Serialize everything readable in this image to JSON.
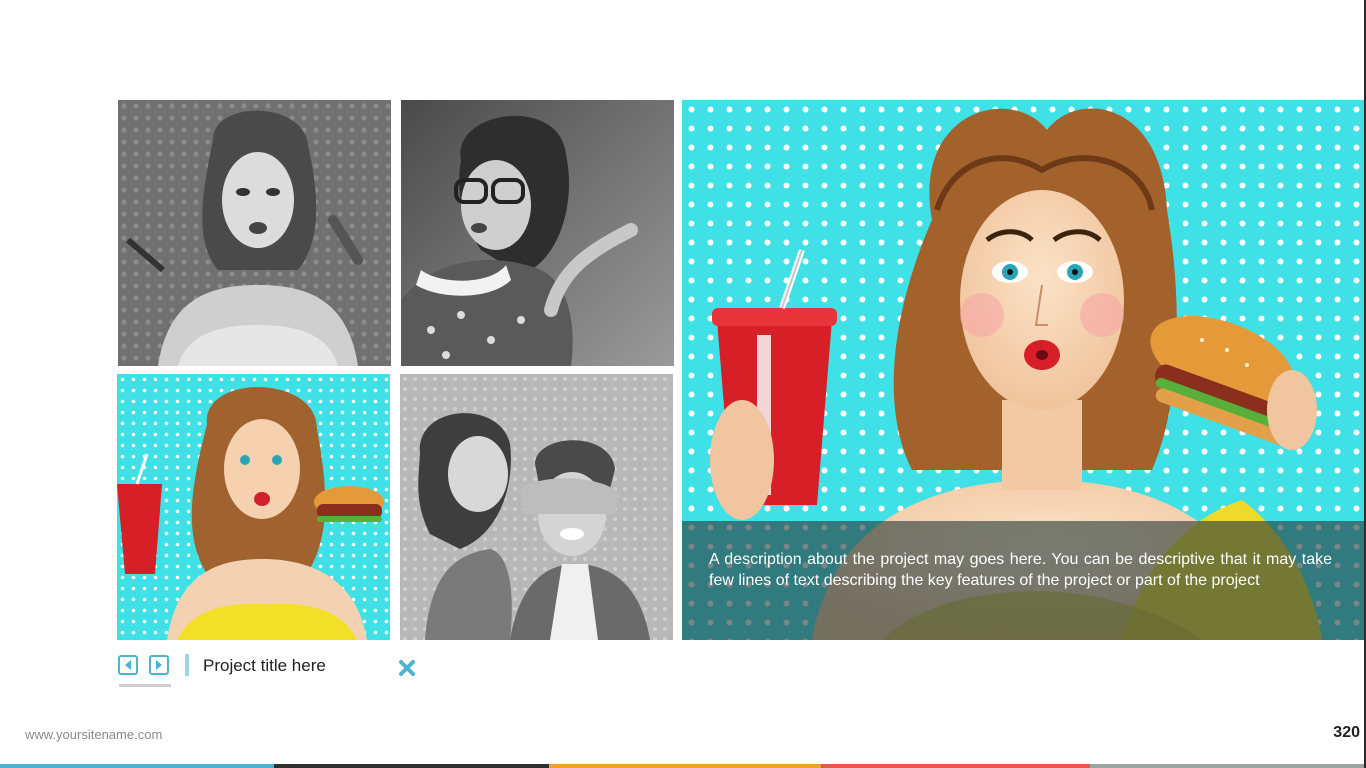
{
  "gallery": {
    "thumbnails": [
      {
        "name": "thumb-woman-mascara",
        "style": "grayscale"
      },
      {
        "name": "thumb-woman-glasses-pointing",
        "style": "grayscale"
      },
      {
        "name": "thumb-woman-soda-burger",
        "style": "color"
      },
      {
        "name": "thumb-couple-eyes-covered",
        "style": "grayscale"
      }
    ]
  },
  "feature": {
    "description": "A description about the project may goes here. You can be descriptive that it may take few lines of text describing the key features of the project or part of the project"
  },
  "controls": {
    "prev_icon": "arrow-left-icon",
    "next_icon": "arrow-right-icon",
    "project_title": "Project title here",
    "close_icon": "close-icon"
  },
  "footer": {
    "site_url": "www.yoursitename.com",
    "page_number": "320"
  },
  "colors": {
    "accent": "#4db3cf",
    "cyan_bg": "#3fe0e6",
    "strip": [
      "#4db3cf",
      "#2f2f2f",
      "#f4a030",
      "#e8534d",
      "#9ea3a6"
    ]
  }
}
